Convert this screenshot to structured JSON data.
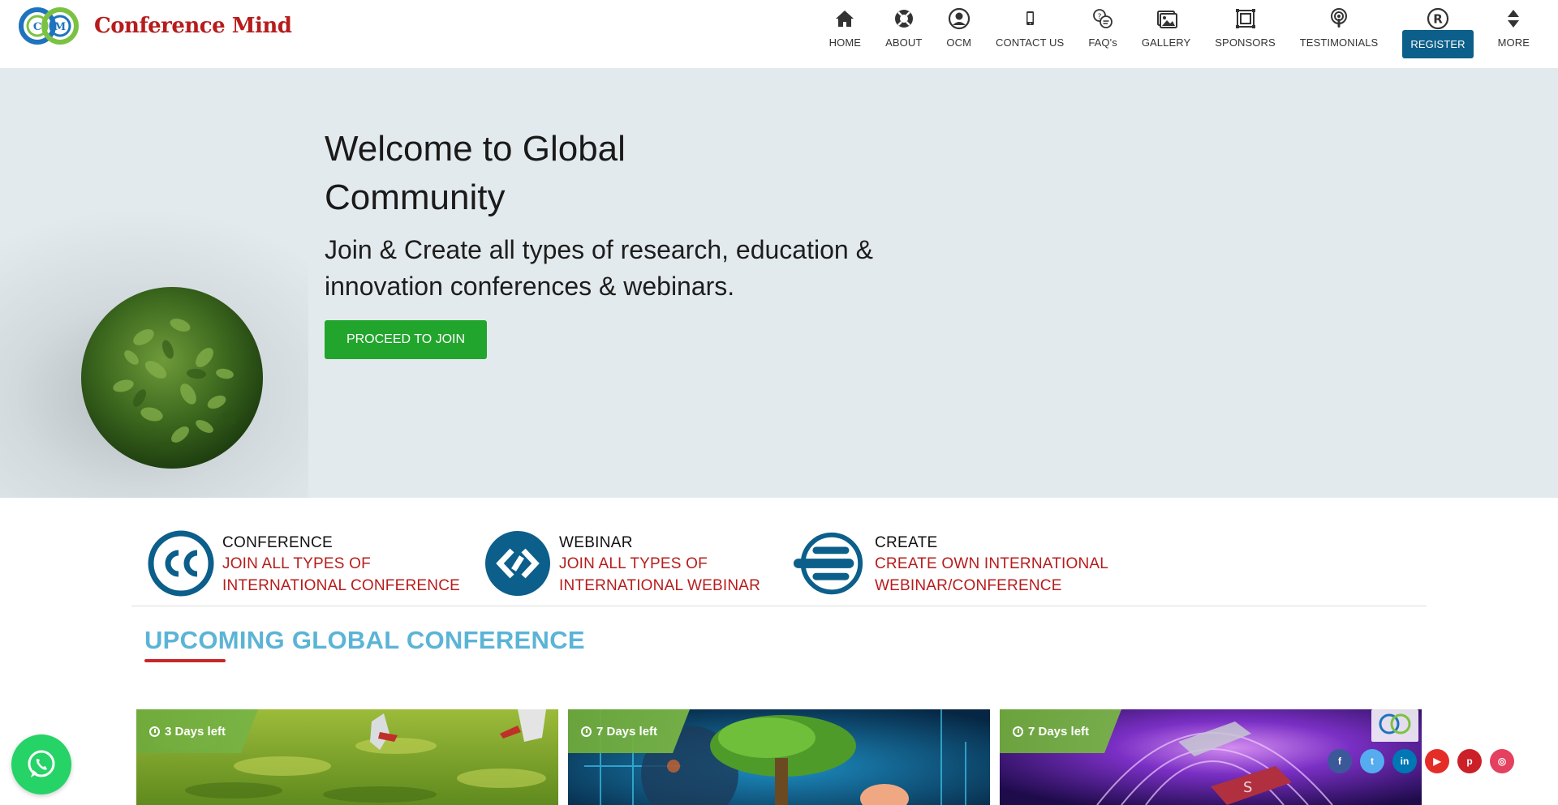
{
  "brand": {
    "name": "Conference Mind",
    "logo_letters": [
      "C",
      "M"
    ]
  },
  "nav": {
    "items": [
      {
        "label": "HOME",
        "icon": "home-icon"
      },
      {
        "label": "ABOUT",
        "icon": "lifebuoy-icon"
      },
      {
        "label": "OCM",
        "icon": "user-circle-icon"
      },
      {
        "label": "CONTACT US",
        "icon": "mobile-phone-icon"
      },
      {
        "label": "FAQ's",
        "icon": "faq-chat-icon"
      },
      {
        "label": "GALLERY",
        "icon": "images-icon"
      },
      {
        "label": "SPONSORS",
        "icon": "frame-icon"
      },
      {
        "label": "TESTIMONIALS",
        "icon": "podcast-icon"
      },
      {
        "label": "REGISTER",
        "icon": "registered-icon"
      },
      {
        "label": "MORE",
        "icon": "sort-arrows-icon"
      }
    ]
  },
  "hero": {
    "title": "Welcome to Global Community",
    "subtitle": "Join & Create all types of research, education & innovation conferences & webinars.",
    "button_label": "PROCEED TO JOIN"
  },
  "features": [
    {
      "title": "CONFERENCE",
      "desc_line1": "JOIN ALL TYPES OF",
      "desc_line2": "INTERNATIONAL CONFERENCE",
      "icon": "cc-icon"
    },
    {
      "title": "WEBINAR",
      "desc_line1": "JOIN ALL TYPES OF",
      "desc_line2": "INTERNATIONAL WEBINAR",
      "icon": "webinar-diamond-icon"
    },
    {
      "title": "CREATE",
      "desc_line1": "CREATE OWN INTERNATIONAL",
      "desc_line2": "WEBINAR/CONFERENCE",
      "icon": "create-lines-icon"
    }
  ],
  "upcoming": {
    "title": "UPCOMING GLOBAL CONFERENCE",
    "cards": [
      {
        "badge": "3 Days left"
      },
      {
        "badge": "7 Days left"
      },
      {
        "badge": "7 Days left"
      }
    ]
  },
  "social": {
    "items": [
      {
        "name": "facebook-icon",
        "glyph": "f",
        "color": "#3b5998"
      },
      {
        "name": "twitter-icon",
        "glyph": "t",
        "color": "#55acee"
      },
      {
        "name": "linkedin-icon",
        "glyph": "in",
        "color": "#0077b5"
      },
      {
        "name": "youtube-icon",
        "glyph": "▶",
        "color": "#e52d27"
      },
      {
        "name": "pinterest-icon",
        "glyph": "p",
        "color": "#cb2027"
      },
      {
        "name": "instagram-icon",
        "glyph": "◎",
        "color": "#e4405f"
      }
    ]
  },
  "colors": {
    "brand_red": "#b71c1c",
    "register_bg": "#0b5f8a",
    "cta_green": "#22a52c",
    "section_blue": "#5bb4d6",
    "hero_bg": "#e3eaed"
  }
}
